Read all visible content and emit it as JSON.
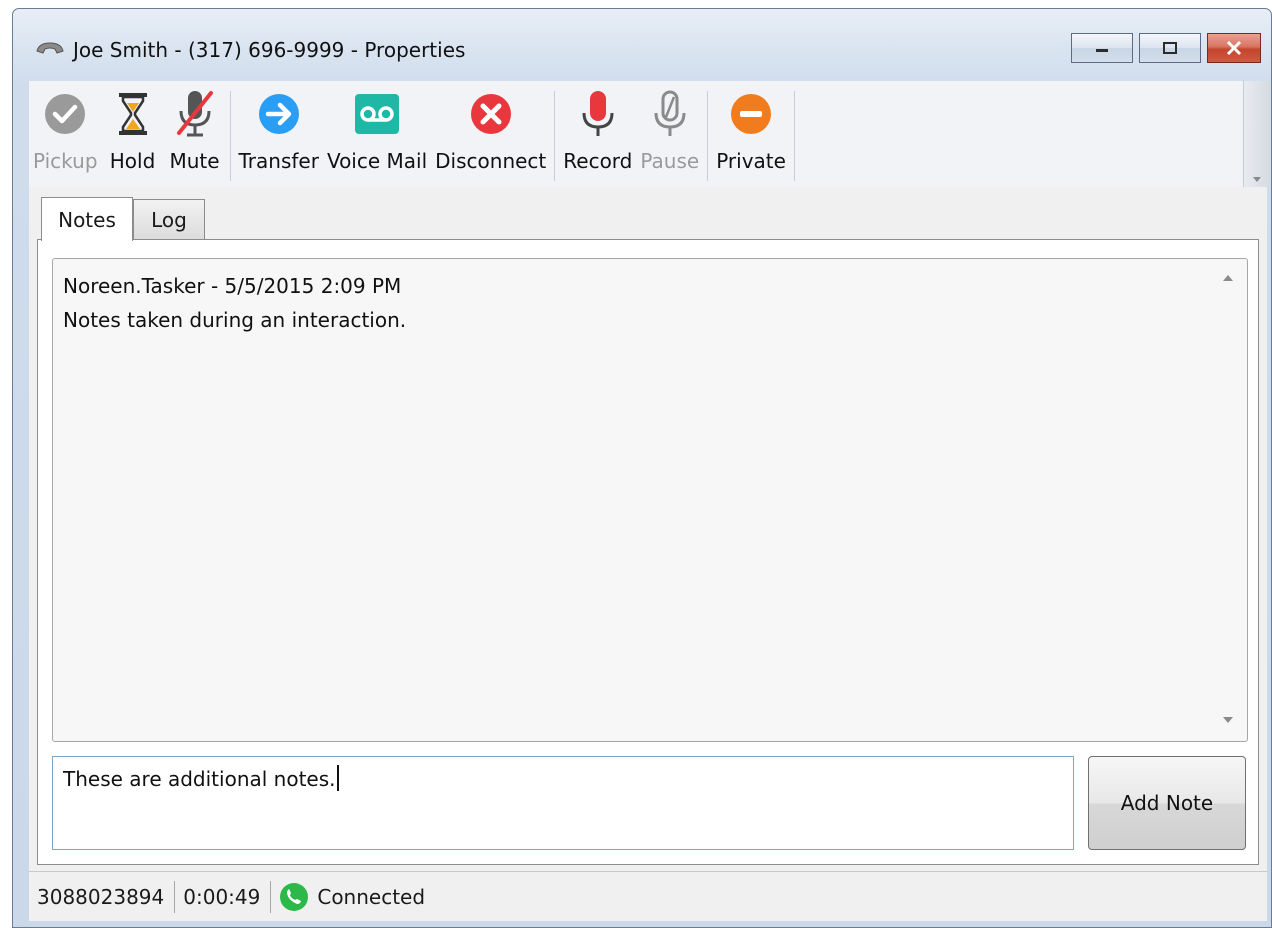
{
  "window": {
    "title": "Joe Smith - (317) 696-9999 - Properties",
    "icon": "phone-handset-icon"
  },
  "toolbar": {
    "items": [
      {
        "label": "Pickup",
        "icon": "check-circle-icon",
        "enabled": false
      },
      {
        "label": "Hold",
        "icon": "hourglass-icon",
        "enabled": true
      },
      {
        "label": "Mute",
        "icon": "microphone-muted-icon",
        "enabled": true
      },
      {
        "label": "Transfer",
        "icon": "arrow-right-circle-icon",
        "enabled": true
      },
      {
        "label": "Voice Mail",
        "icon": "voicemail-icon",
        "enabled": true
      },
      {
        "label": "Disconnect",
        "icon": "x-circle-icon",
        "enabled": true
      },
      {
        "label": "Record",
        "icon": "microphone-red-icon",
        "enabled": true
      },
      {
        "label": "Pause",
        "icon": "microphone-outline-icon",
        "enabled": false
      },
      {
        "label": "Private",
        "icon": "minus-circle-icon",
        "enabled": true
      }
    ]
  },
  "tabs": [
    {
      "label": "Notes",
      "active": true
    },
    {
      "label": "Log",
      "active": false
    }
  ],
  "notes": {
    "entries": [
      {
        "header": "Noreen.Tasker - 5/5/2015 2:09 PM",
        "text": "Notes taken during an interaction."
      }
    ],
    "input_value": "These are additional notes.",
    "add_button_label": "Add Note"
  },
  "status": {
    "number": "3088023894",
    "duration": "0:00:49",
    "state": "Connected",
    "state_icon": "phone-connected-icon"
  },
  "colors": {
    "transfer": "#2a9df4",
    "voicemail": "#1fb7a6",
    "disconnect": "#e8383d",
    "record": "#e8383d",
    "private": "#f07c1e",
    "hold": "#f2a51f",
    "connected": "#2db84a"
  }
}
